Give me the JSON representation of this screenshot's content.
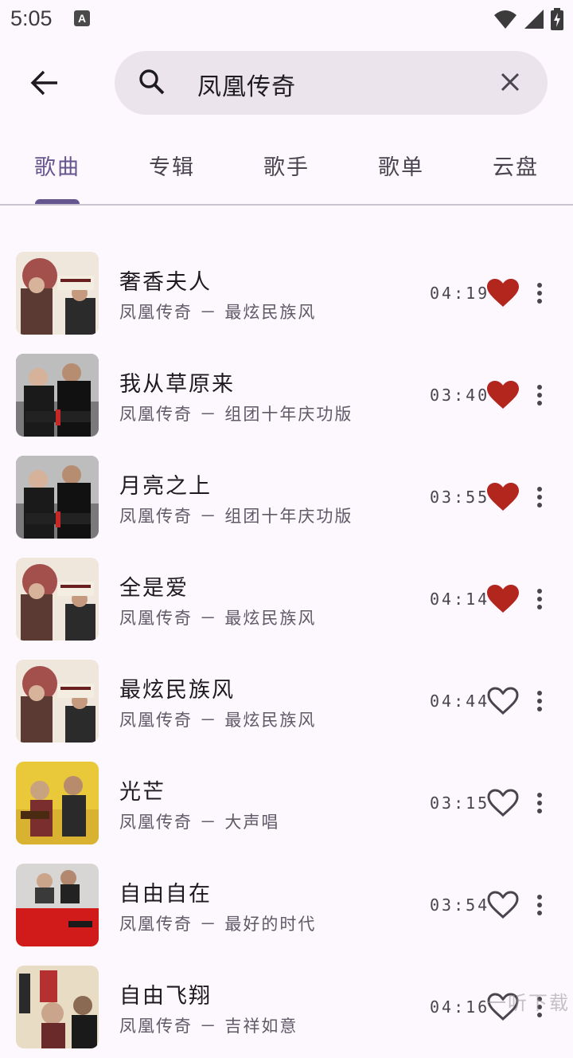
{
  "status_bar": {
    "time": "5:05",
    "notif_icon": "A"
  },
  "search": {
    "query": "凤凰传奇"
  },
  "tabs": [
    {
      "label": "歌曲",
      "active": true
    },
    {
      "label": "专辑",
      "active": false
    },
    {
      "label": "歌手",
      "active": false
    },
    {
      "label": "歌单",
      "active": false
    },
    {
      "label": "云盘",
      "active": false
    }
  ],
  "songs": [
    {
      "title": "奢香夫人",
      "subtitle": "凤凰传奇 － 最炫民族风",
      "duration": "04:19",
      "liked": true,
      "cover": "cover-a"
    },
    {
      "title": "我从草原来",
      "subtitle": "凤凰传奇 － 组团十年庆功版",
      "duration": "03:40",
      "liked": true,
      "cover": "cover-b"
    },
    {
      "title": "月亮之上",
      "subtitle": "凤凰传奇 － 组团十年庆功版",
      "duration": "03:55",
      "liked": true,
      "cover": "cover-b"
    },
    {
      "title": "全是爱",
      "subtitle": "凤凰传奇 － 最炫民族风",
      "duration": "04:14",
      "liked": true,
      "cover": "cover-a"
    },
    {
      "title": "最炫民族风",
      "subtitle": "凤凰传奇 － 最炫民族风",
      "duration": "04:44",
      "liked": false,
      "cover": "cover-a"
    },
    {
      "title": "光芒",
      "subtitle": "凤凰传奇 － 大声唱",
      "duration": "03:15",
      "liked": false,
      "cover": "cover-c"
    },
    {
      "title": "自由自在",
      "subtitle": "凤凰传奇 － 最好的时代",
      "duration": "03:54",
      "liked": false,
      "cover": "cover-d"
    },
    {
      "title": "自由飞翔",
      "subtitle": "凤凰传奇 － 吉祥如意",
      "duration": "04:16",
      "liked": false,
      "cover": "cover-e"
    }
  ],
  "watermark": "一听下载",
  "colors": {
    "accent": "#65558f",
    "heart_liked": "#b3261e",
    "background": "#fdf7fe",
    "search_bg": "#ebe4ed"
  }
}
